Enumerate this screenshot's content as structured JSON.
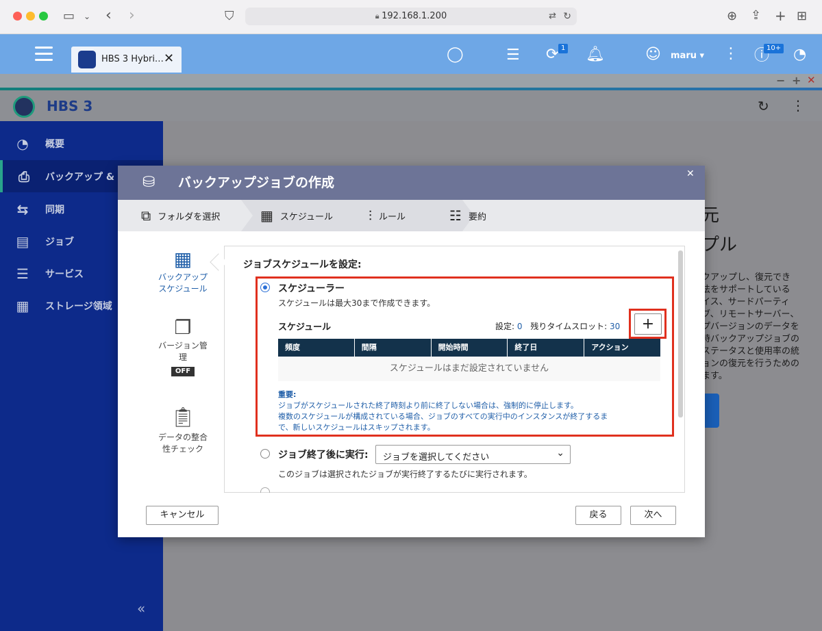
{
  "browser": {
    "url": "192.168.1.200",
    "tab_title": "HBS 3 Hybri…"
  },
  "qts": {
    "user": "maru ▾",
    "badge_backup": "1",
    "badge_notify": "10+"
  },
  "app": {
    "title": "HBS 3"
  },
  "sidebar": {
    "items": [
      {
        "label": "概要",
        "icon": "gauge-icon"
      },
      {
        "label": "バックアップ & ",
        "icon": "backup-icon"
      },
      {
        "label": "同期",
        "icon": "sync-icon"
      },
      {
        "label": "ジョブ",
        "icon": "job-icon"
      },
      {
        "label": "サービス",
        "icon": "service-icon"
      },
      {
        "label": "ストレージ領域",
        "icon": "storage-icon"
      }
    ],
    "collapse_label": "«"
  },
  "background": {
    "heading1": "元",
    "heading2": "プル",
    "para": [
      "クアップし、復元でき",
      "法をサポートしている",
      "イス、サードパーティ",
      "ブ、リモートサーバー、",
      "プバージョンのデータを",
      "時バックアップジョブの",
      "ステータスと使用率の統",
      "ョンの復元を行うための",
      "ます。"
    ]
  },
  "modal": {
    "title": "バックアップジョブの作成",
    "steps": [
      {
        "label": "フォルダを選択",
        "icon": "folder-select-icon"
      },
      {
        "label": "スケジュール",
        "icon": "calendar-icon"
      },
      {
        "label": "ルール",
        "icon": "sliders-icon"
      },
      {
        "label": "要約",
        "icon": "summary-icon"
      }
    ],
    "left_nav": [
      {
        "label1": "バックアップ",
        "label2": "スケジュール"
      },
      {
        "label1": "バージョン管",
        "label2": "理",
        "badge": "OFF"
      },
      {
        "label1": "データの整合",
        "label2": "性チェック"
      }
    ],
    "section_title": "ジョブスケジュールを設定:",
    "scheduler": {
      "label": "スケジューラー",
      "desc": "スケジュールは最大30まで作成できます。",
      "schedule_label": "スケジュール",
      "set_label": "設定: ",
      "set_count": "0",
      "slots_label": "残りタイムスロット: ",
      "slots_count": "30",
      "add_label": "+",
      "columns": [
        "頻度",
        "間隔",
        "開始時間",
        "終了日",
        "アクション"
      ],
      "empty": "スケジュールはまだ設定されていません",
      "note_title": "重要:",
      "note1": "ジョブがスケジュールされた終了時刻より前に終了しない場合は、強制的に停止します。",
      "note2": "複数のスケジュールが構成されている場合、ジョブのすべての実行中のインスタンスが終了するま",
      "note3": "で、新しいスケジュールはスキップされます。"
    },
    "after_job": {
      "label": "ジョブ終了後に実行:",
      "select_value": "ジョブを選択してください",
      "desc": "このジョブは選択されたジョブが実行終了するたびに実行されます。"
    },
    "buttons": {
      "cancel": "キャンセル",
      "back": "戻る",
      "next": "次へ"
    }
  }
}
